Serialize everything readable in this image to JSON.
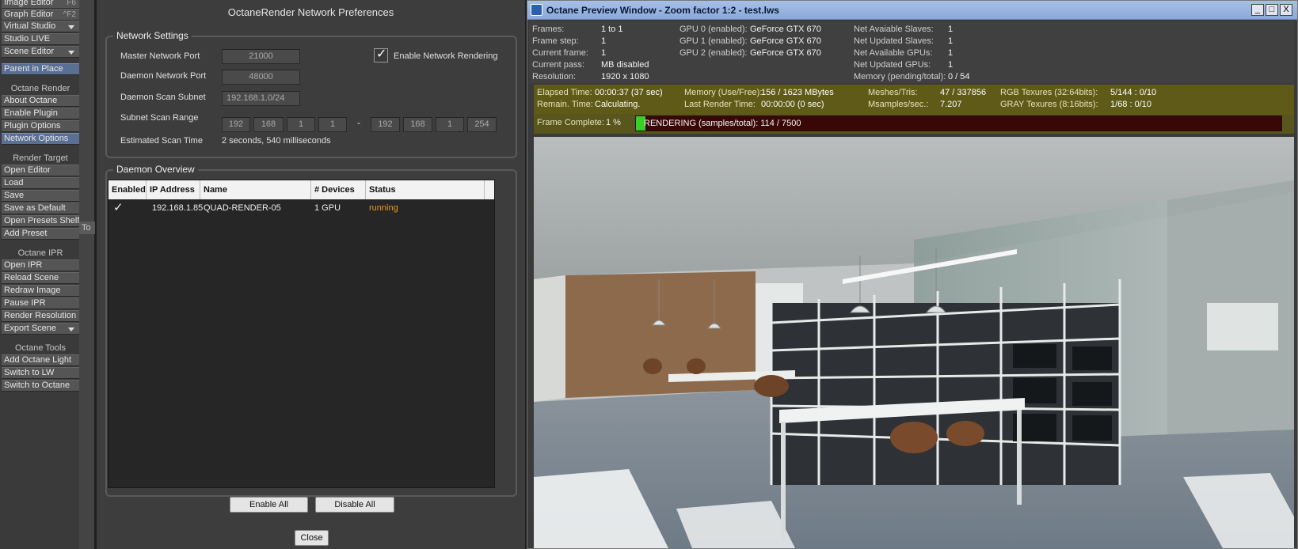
{
  "lw_menu": {
    "top_items": [
      {
        "label": "Image Editor",
        "shortcut": "F6"
      },
      {
        "label": "Graph Editor",
        "shortcut": "^F2"
      },
      {
        "label": "Virtual Studio"
      },
      {
        "label": "Studio LIVE"
      },
      {
        "label": "Scene Editor"
      }
    ],
    "parent_in_place": "Parent in Place",
    "octane_render": {
      "heading": "Octane Render",
      "items": [
        "About Octane",
        "Enable Plugin",
        "Plugin Options",
        "Network Options"
      ]
    },
    "render_target": {
      "heading": "Render Target",
      "items": [
        "Open Editor",
        "Load",
        "Save",
        "Save as Default",
        "Open Presets Shelf",
        "Add Preset"
      ]
    },
    "octane_ipr": {
      "heading": "Octane IPR",
      "items": [
        "Open IPR",
        "Reload Scene",
        "Redraw Image",
        "Pause IPR",
        "Render Resolution",
        "Export Scene"
      ]
    },
    "octane_tools": {
      "heading": "Octane Tools",
      "items": [
        "Add Octane Light",
        "Switch to LW",
        "Switch to Octane"
      ]
    },
    "side_tab": "To"
  },
  "network_dialog": {
    "title": "OctaneRender Network Preferences",
    "settings_title": "Network Settings",
    "master_port_label": "Master Network Port",
    "master_port_value": "21000",
    "daemon_port_label": "Daemon Network Port",
    "daemon_port_value": "48000",
    "subnet_label": "Daemon Scan Subnet",
    "subnet_value": "192.168.1.0/24",
    "scan_range_label": "Subnet Scan Range",
    "scan_range_from": [
      "192",
      "168",
      "1",
      "1"
    ],
    "scan_range_sep": "-",
    "scan_range_to": [
      "192",
      "168",
      "1",
      "254"
    ],
    "scan_time_label": "Estimated Scan Time",
    "scan_time_value": "2 seconds, 540 milliseconds",
    "enable_network_label": "Enable Network Rendering",
    "enable_network_checked": true,
    "overview_title": "Daemon Overview",
    "table_headers": [
      "Enabled",
      "IP Address",
      "Name",
      "# Devices",
      "Status"
    ],
    "daemons": [
      {
        "enabled": true,
        "ip": "192.168.1.85",
        "name": "QUAD-RENDER-05",
        "devices": "1 GPU",
        "status": "running"
      }
    ],
    "status_color": "#e89a22",
    "enable_all_label": "Enable All",
    "disable_all_label": "Disable All",
    "close_label": "Close"
  },
  "preview": {
    "title": "Octane Preview Window - Zoom factor 1:2 - test.lws",
    "window_buttons": [
      "_",
      "□",
      "X"
    ],
    "frame_stats": [
      {
        "label": "Frames:",
        "value": "1 to 1"
      },
      {
        "label": "Frame step:",
        "value": "1"
      },
      {
        "label": "Current frame:",
        "value": "1"
      },
      {
        "label": "Current pass:",
        "value": "MB disabled"
      },
      {
        "label": "Resolution:",
        "value": "1920 x 1080"
      }
    ],
    "gpus": [
      {
        "label": "GPU  0 (enabled):",
        "value": "GeForce GTX 670"
      },
      {
        "label": "GPU  1 (enabled):",
        "value": "GeForce GTX 670"
      },
      {
        "label": "GPU  2 (enabled):",
        "value": "GeForce GTX 670"
      }
    ],
    "net_stats": [
      {
        "label": "Net Avaiable Slaves:",
        "value": "1"
      },
      {
        "label": "Net Updated Slaves:",
        "value": "1"
      },
      {
        "label": "Net Available GPUs:",
        "value": "1"
      },
      {
        "label": "Net Updated GPUs:",
        "value": "1"
      },
      {
        "label": "Memory (pending/total):",
        "value": "0 / 54"
      }
    ],
    "elapsed_label": "Elapsed Time:",
    "elapsed_value": "00:00:37 (37 sec)",
    "remain_label": "Remain. Time:",
    "remain_value": "Calculating.",
    "memory_label": "Memory (Use/Free):",
    "memory_value": "156 / 1623 MBytes",
    "last_render_label": "Last Render Time:",
    "last_render_value": "00:00:00 (0 sec)",
    "meshes_label": "Meshes/Tris:",
    "meshes_value": "47 / 337856",
    "msamples_label": "Msamples/sec.:",
    "msamples_value": "7.207",
    "rgb_label": "RGB Texures (32:64bits):",
    "rgb_value": "5/144 : 0/10",
    "gray_label": "GRAY Texures (8:16bits):",
    "gray_value": "1/68 : 0/10",
    "frame_complete_label": "Frame Complete:",
    "frame_complete_value": "1 %",
    "progress_fraction": 0.015,
    "rendering_text": "RENDERING (samples/total): 114 / 7500",
    "progress_color": "#36d026"
  }
}
